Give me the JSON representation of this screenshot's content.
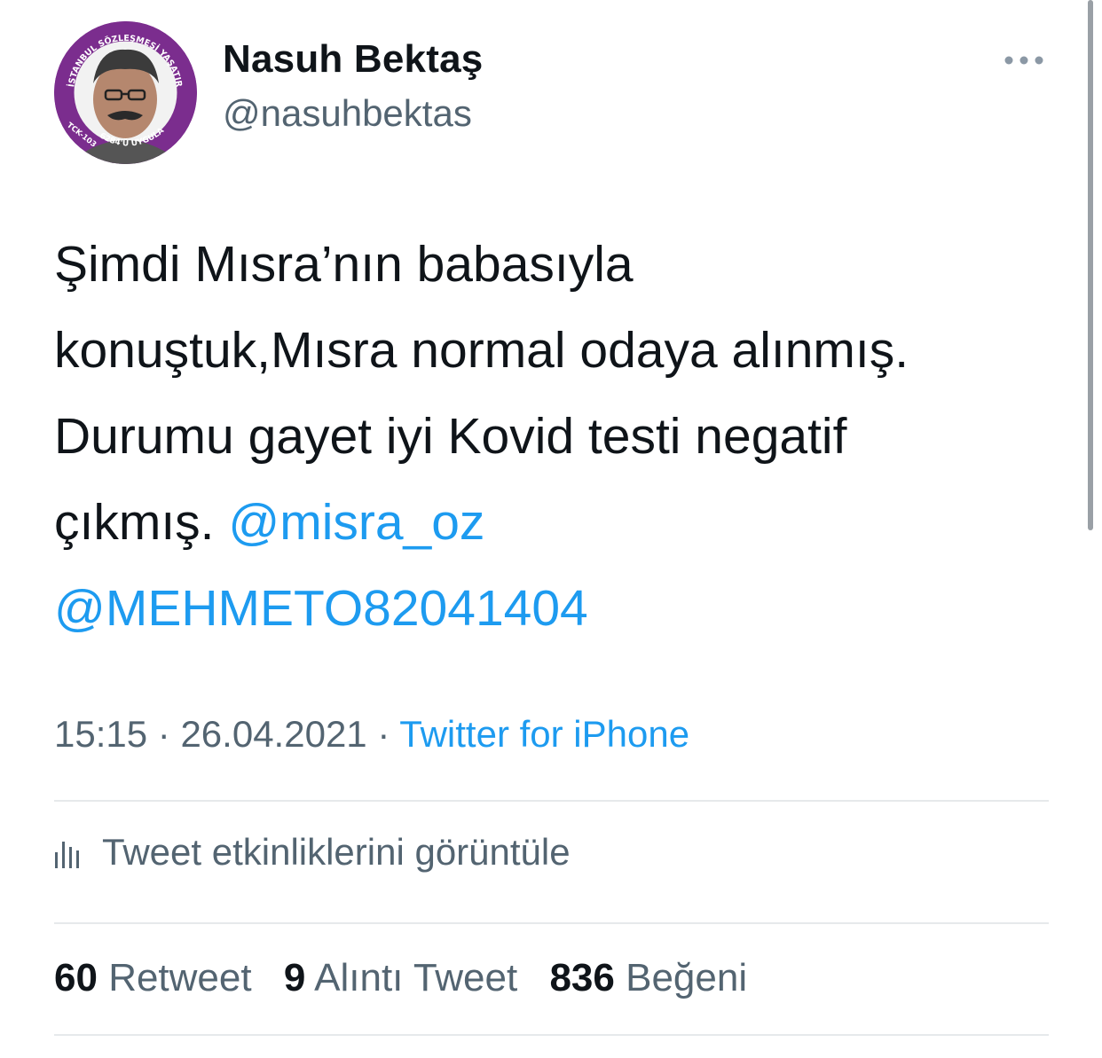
{
  "author": {
    "display_name": "Nasuh Bektaş",
    "handle": "@nasuhbektas",
    "avatar_badge_top": "İSTANBUL SÖZLEŞMESİ YAŞATIR",
    "avatar_badge_left": "TCK-103",
    "avatar_badge_bottom": "6284'Ü UYGULA"
  },
  "tweet": {
    "line1": "Şimdi Mısra’nın babasıyla",
    "line2": "konuştuk,Mısra normal odaya alınmış.",
    "line3": "Durumu gayet iyi Kovid testi negatif",
    "line4_text": "çıkmış.",
    "mention1": "@misra_oz",
    "mention2": "@MEHMETO82041404"
  },
  "meta": {
    "time": "15:15",
    "separator": "·",
    "date": "26.04.2021",
    "source": "Twitter for iPhone"
  },
  "activity": {
    "label": "Tweet etkinliklerini görüntüle"
  },
  "stats": {
    "retweets_count": "60",
    "retweets_label": "Retweet",
    "quotes_count": "9",
    "quotes_label": "Alıntı Tweet",
    "likes_count": "836",
    "likes_label": "Beğeni"
  },
  "colors": {
    "link": "#1d9bf0",
    "secondary_text": "#536471",
    "primary_text": "#0f1419",
    "avatar_ring": "#7b2d8e"
  }
}
